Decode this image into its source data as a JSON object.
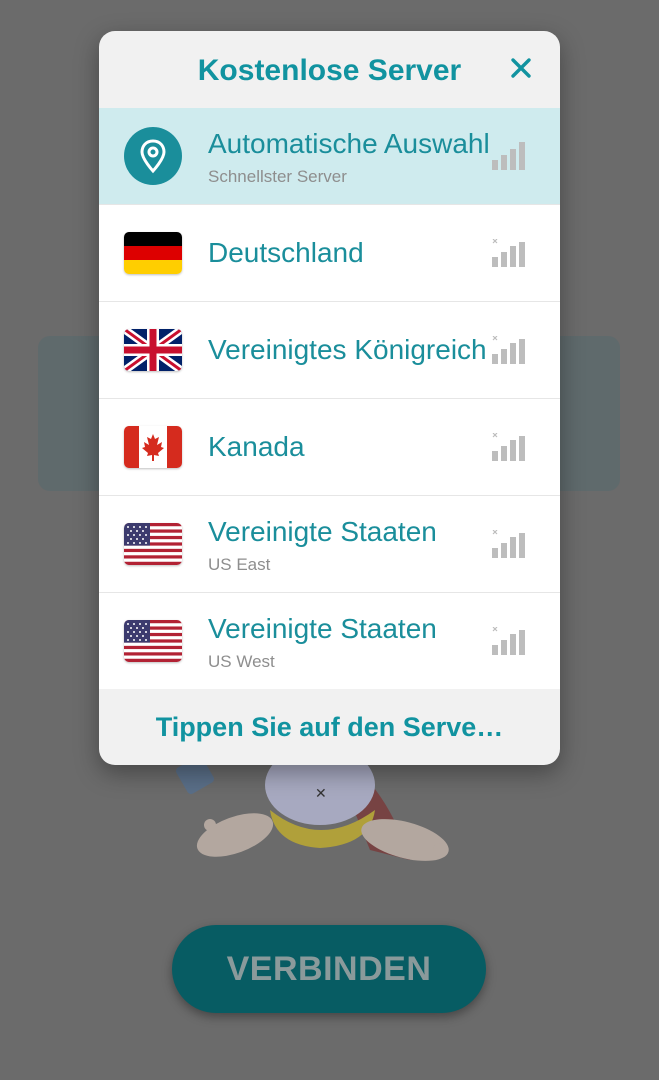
{
  "dialog": {
    "title": "Kostenlose Server",
    "footer": "Tippen Sie auf den Serve…"
  },
  "servers": [
    {
      "name": "Automatische Auswahl",
      "subtitle": "Schnellster Server",
      "icon": "location-pin-icon",
      "selected": true
    },
    {
      "name": "Deutschland",
      "subtitle": "",
      "icon": "germany-flag-icon"
    },
    {
      "name": "Vereinigtes Königreich",
      "subtitle": "",
      "icon": "uk-flag-icon"
    },
    {
      "name": "Kanada",
      "subtitle": "",
      "icon": "canada-flag-icon"
    },
    {
      "name": "Vereinigte Staaten",
      "subtitle": "US East",
      "icon": "usa-flag-icon"
    },
    {
      "name": "Vereinigte Staaten",
      "subtitle": "US West",
      "icon": "usa-flag-icon"
    }
  ],
  "background": {
    "connect_button": "VERBINDEN"
  },
  "colors": {
    "accent": "#1193a0",
    "selected_row": "#cfebee",
    "button": "#075c63"
  }
}
